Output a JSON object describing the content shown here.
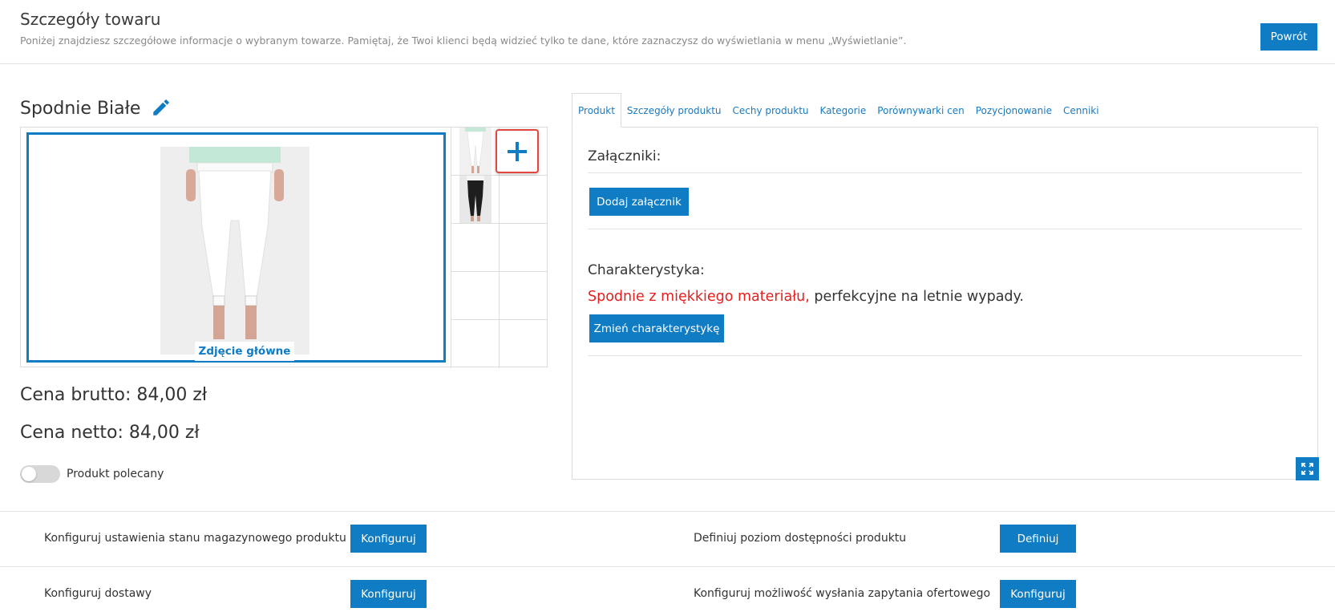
{
  "header": {
    "title": "Szczegóły towaru",
    "subtitle": "Poniżej znajdziesz szczegółowe informacje o wybranym towarze. Pamiętaj, że Twoi klienci będą widzieć tylko te dane, które zaznaczysz do wyświetlania w menu „Wyświetlanie”.",
    "back_label": "Powrót"
  },
  "product": {
    "name": "Spodnie Białe",
    "edit_icon": "pencil-icon",
    "main_photo_label": "Zdjęcie główne",
    "add_photo_icon": "plus-icon",
    "price_gross": "Cena brutto: 84,00 zł",
    "price_net": "Cena netto: 84,00 zł",
    "featured_label": "Produkt polecany",
    "featured_on": false
  },
  "tabs": [
    {
      "label": "Produkt",
      "active": true
    },
    {
      "label": "Szczegóły produktu",
      "active": false
    },
    {
      "label": "Cechy produktu",
      "active": false
    },
    {
      "label": "Kategorie",
      "active": false
    },
    {
      "label": "Porównywarki cen",
      "active": false
    },
    {
      "label": "Pozycjonowanie",
      "active": false
    },
    {
      "label": "Cenniki",
      "active": false
    }
  ],
  "panel": {
    "attachments_heading": "Załączniki:",
    "add_attachment_label": "Dodaj załącznik",
    "characteristic_heading": "Charakterystyka:",
    "characteristic_highlight": "Spodnie z miękkiego materiału,",
    "characteristic_rest": " perfekcyjne na letnie wypady.",
    "change_characteristic_label": "Zmień charakterystykę",
    "expand_icon": "expand-icon"
  },
  "config": {
    "stock_label": "Konfiguruj ustawienia stanu magazynowego produktu",
    "stock_button": "Konfiguruj",
    "availability_label": "Definiuj poziom dostępności produktu",
    "availability_button": "Definiuj",
    "delivery_label": "Konfiguruj dostawy",
    "delivery_button": "Konfiguruj",
    "inquiry_label": "Konfiguruj możliwość wysłania zapytania ofertowego",
    "inquiry_button": "Konfiguruj"
  },
  "colors": {
    "accent": "#0f7cc4",
    "highlight_red": "#e61e1e",
    "add_border": "#e0473f"
  }
}
